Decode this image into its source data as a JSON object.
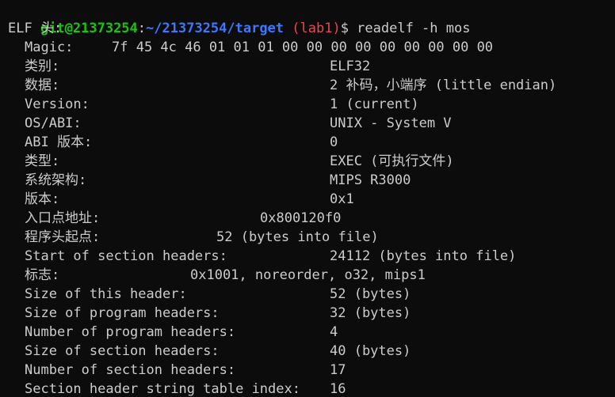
{
  "prompt": {
    "user_host": "git@21373254",
    "separator": ":",
    "path": "~/21373254/target",
    "branch": " (lab1)",
    "dollar": "$ ",
    "command": "readelf -h mos"
  },
  "header_title": "ELF 头:",
  "rows": [
    {
      "label": "Magic:",
      "value": "7f 45 4c 46 01 01 01 00 00 00 00 00 00 00 00 00"
    },
    {
      "label": "类别:",
      "value": "ELF32"
    },
    {
      "label": "数据:",
      "value": "2 补码，小端序 (little endian)"
    },
    {
      "label": "Version:",
      "value": "1 (current)"
    },
    {
      "label": "OS/ABI:",
      "value": "UNIX - System V"
    },
    {
      "label": "ABI 版本:",
      "value": "0"
    },
    {
      "label": "类型:",
      "value": "EXEC (可执行文件)"
    },
    {
      "label": "系统架构:",
      "value": "MIPS R3000"
    },
    {
      "label": "版本:",
      "value": "0x1"
    },
    {
      "label": "入口点地址:",
      "value": "0x800120f0"
    },
    {
      "label": "程序头起点:",
      "value": "52 (bytes into file)"
    },
    {
      "label": "Start of section headers:",
      "value": "24112 (bytes into file)"
    },
    {
      "label": "标志:",
      "value": "0x1001, noreorder, o32, mips1"
    },
    {
      "label": "Size of this header:",
      "value": "52 (bytes)"
    },
    {
      "label": "Size of program headers:",
      "value": "32 (bytes)"
    },
    {
      "label": "Number of program headers:",
      "value": "4"
    },
    {
      "label": "Size of section headers:",
      "value": "40 (bytes)"
    },
    {
      "label": "Number of section headers:",
      "value": "17"
    },
    {
      "label": "Section header string table index:",
      "value": "16"
    }
  ]
}
